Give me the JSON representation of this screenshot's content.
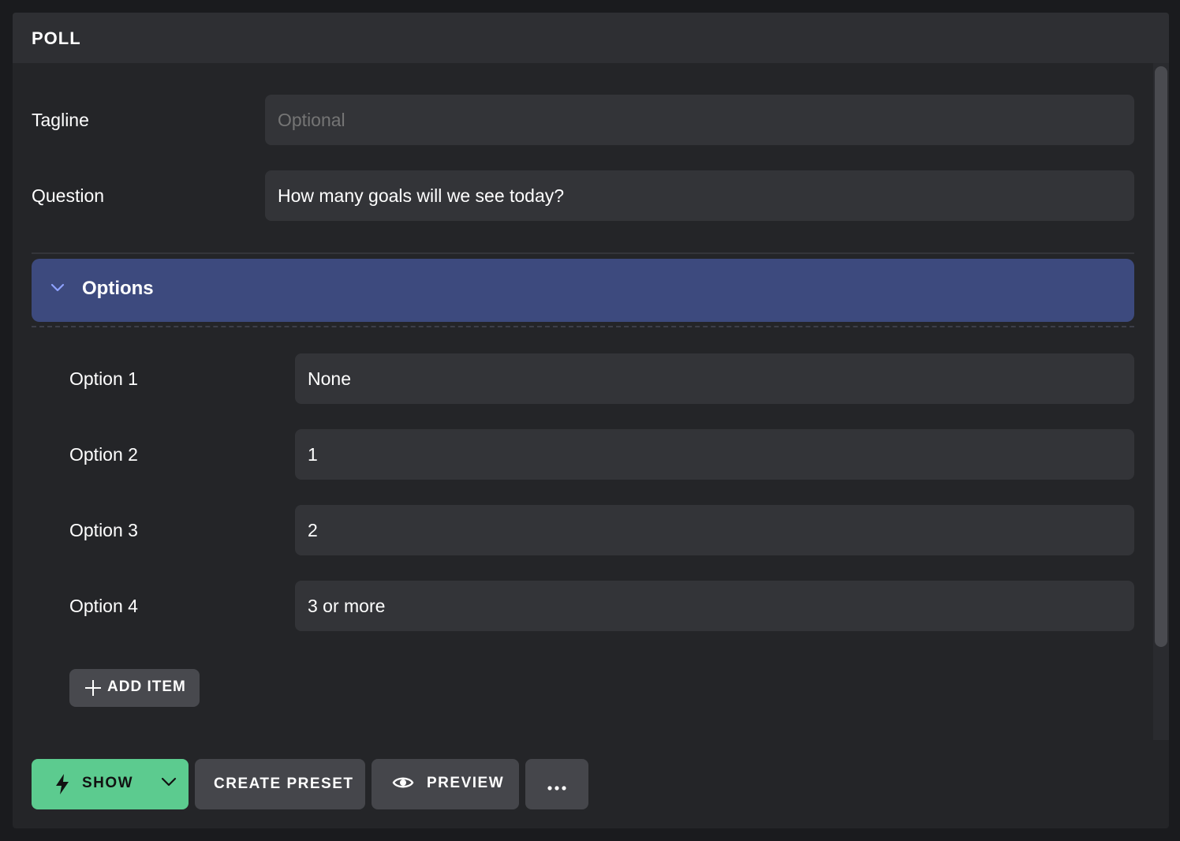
{
  "panel": {
    "title": "POLL"
  },
  "fields": {
    "tagline": {
      "label": "Tagline",
      "placeholder": "Optional",
      "value": ""
    },
    "question": {
      "label": "Question",
      "value": "How many goals will we see today?"
    }
  },
  "options_section": {
    "title": "Options",
    "items": [
      {
        "label": "Option 1",
        "value": "None"
      },
      {
        "label": "Option 2",
        "value": "1"
      },
      {
        "label": "Option 3",
        "value": "2"
      },
      {
        "label": "Option 4",
        "value": "3 or more"
      }
    ],
    "add_item_label": "ADD ITEM"
  },
  "footer": {
    "show_label": "SHOW",
    "create_preset_label": "CREATE PRESET",
    "preview_label": "PREVIEW"
  },
  "colors": {
    "background": "#242528",
    "accent_section": "#3d4a7e",
    "show_button": "#5ccb8f",
    "input_bg": "#333438"
  },
  "icons": {
    "options_toggle": "chevron-down-icon",
    "add_item": "plus-icon",
    "show": "lightning-bolt-icon",
    "show_dropdown": "chevron-down-icon",
    "preview": "eye-icon",
    "more": "more-horizontal-icon"
  }
}
